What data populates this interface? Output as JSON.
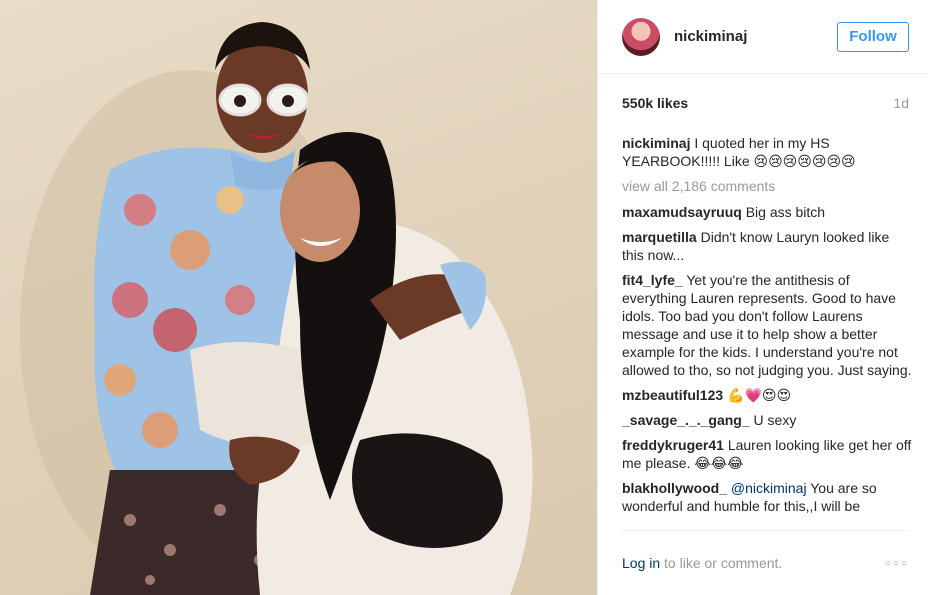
{
  "header": {
    "username": "nickiminaj",
    "follow_label": "Follow"
  },
  "meta": {
    "likes": "550k likes",
    "age": "1d"
  },
  "caption": {
    "user": "nickiminaj",
    "text": "I quoted her in my HS YEARBOOK!!!!! Like 😢😢😢😢😢😢😢"
  },
  "view_all": "view all 2,186 comments",
  "comments": [
    {
      "user": "maxamudsayruuq",
      "text": "Big ass bitch"
    },
    {
      "user": "marquetilla",
      "text": "Didn't know Lauryn looked like this now..."
    },
    {
      "user": "fit4_lyfe_",
      "text": "Yet you're the antithesis of everything Lauren represents. Good to have idols. Too bad you don't follow Laurens message and use it to help show a better example for the kids. I understand you're not allowed to tho, so not judging you. Just saying."
    },
    {
      "user": "mzbeautiful123",
      "text": "💪💗😍😍"
    },
    {
      "user": "_savage_._._gang_",
      "text": "U sexy"
    },
    {
      "user": "freddykruger41",
      "text": "Lauren looking like get her off me please. 😂😂😂"
    },
    {
      "user": "blakhollywood_",
      "mention": "@nickiminaj",
      "text": "You are so wonderful and humble for this,,I will be"
    }
  ],
  "footer": {
    "login_link": "Log in",
    "login_rest": " to like or comment.",
    "more_icon": "more-options-icon",
    "more_glyph": "○○○"
  },
  "colors": {
    "accent": "#3897f0",
    "link": "#003569",
    "muted": "#999999",
    "text": "#262626"
  }
}
